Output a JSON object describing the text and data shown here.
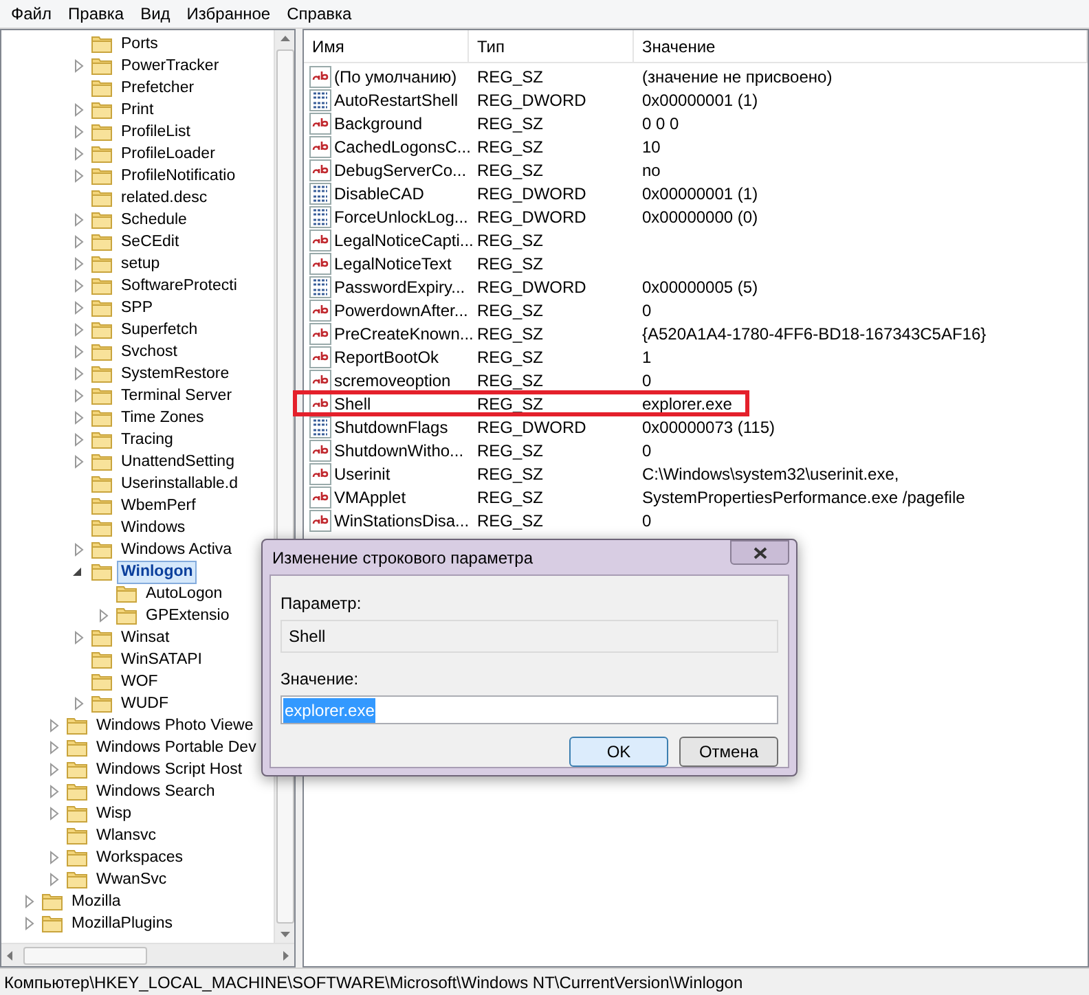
{
  "menu": [
    "Файл",
    "Правка",
    "Вид",
    "Избранное",
    "Справка"
  ],
  "tree": {
    "items": [
      {
        "children": [
          {
            "children": [
              {
                "label": "Ports",
                "kind": "leaf",
                "selected": false
              },
              {
                "label": "PowerTracker",
                "kind": "collapsed",
                "selected": false
              },
              {
                "label": "Prefetcher",
                "kind": "leaf",
                "selected": false
              },
              {
                "label": "Print",
                "kind": "collapsed",
                "selected": false
              },
              {
                "label": "ProfileList",
                "kind": "collapsed",
                "selected": false
              },
              {
                "label": "ProfileLoader",
                "kind": "collapsed",
                "selected": false
              },
              {
                "label": "ProfileNotificatio",
                "kind": "collapsed",
                "selected": false
              },
              {
                "label": "related.desc",
                "kind": "leaf",
                "selected": false
              },
              {
                "label": "Schedule",
                "kind": "collapsed",
                "selected": false
              },
              {
                "label": "SeCEdit",
                "kind": "collapsed",
                "selected": false
              },
              {
                "label": "setup",
                "kind": "collapsed",
                "selected": false
              },
              {
                "label": "SoftwareProtecti",
                "kind": "collapsed",
                "selected": false
              },
              {
                "label": "SPP",
                "kind": "collapsed",
                "selected": false
              },
              {
                "label": "Superfetch",
                "kind": "collapsed",
                "selected": false
              },
              {
                "label": "Svchost",
                "kind": "collapsed",
                "selected": false
              },
              {
                "label": "SystemRestore",
                "kind": "collapsed",
                "selected": false
              },
              {
                "label": "Terminal Server",
                "kind": "collapsed",
                "selected": false
              },
              {
                "label": "Time Zones",
                "kind": "collapsed",
                "selected": false
              },
              {
                "label": "Tracing",
                "kind": "collapsed",
                "selected": false
              },
              {
                "label": "UnattendSetting",
                "kind": "collapsed",
                "selected": false
              },
              {
                "label": "Userinstallable.d",
                "kind": "leaf",
                "selected": false
              },
              {
                "label": "WbemPerf",
                "kind": "leaf",
                "selected": false
              },
              {
                "label": "Windows",
                "kind": "leaf",
                "selected": false
              },
              {
                "label": "Windows Activa",
                "kind": "collapsed",
                "selected": false
              },
              {
                "label": "Winlogon",
                "kind": "expanded",
                "selected": true,
                "children": [
                  {
                    "label": "AutoLogon",
                    "kind": "leaf",
                    "selected": false
                  },
                  {
                    "label": "GPExtensio",
                    "kind": "collapsed",
                    "selected": false
                  }
                ]
              },
              {
                "label": "Winsat",
                "kind": "collapsed",
                "selected": false
              },
              {
                "label": "WinSATAPI",
                "kind": "leaf",
                "selected": false
              },
              {
                "label": "WOF",
                "kind": "leaf",
                "selected": false
              },
              {
                "label": "WUDF",
                "kind": "collapsed",
                "selected": false
              }
            ]
          },
          {
            "label": "Windows Photo Viewe",
            "kind": "collapsed",
            "selected": false
          },
          {
            "label": "Windows Portable Dev",
            "kind": "collapsed",
            "selected": false
          },
          {
            "label": "Windows Script Host",
            "kind": "collapsed",
            "selected": false
          },
          {
            "label": "Windows Search",
            "kind": "collapsed",
            "selected": false
          },
          {
            "label": "Wisp",
            "kind": "collapsed",
            "selected": false
          },
          {
            "label": "Wlansvc",
            "kind": "leaf",
            "selected": false
          },
          {
            "label": "Workspaces",
            "kind": "collapsed",
            "selected": false
          },
          {
            "label": "WwanSvc",
            "kind": "collapsed",
            "selected": false
          }
        ]
      },
      {
        "label": "Mozilla",
        "kind": "collapsed",
        "selected": false
      },
      {
        "label": "MozillaPlugins",
        "kind": "collapsed",
        "selected": false
      }
    ]
  },
  "table": {
    "columns": [
      "Имя",
      "Тип",
      "Значение"
    ],
    "rows": [
      {
        "kind": "string",
        "name": "(По умолчанию)",
        "type": "REG_SZ",
        "value": "(значение не присвоено)",
        "highlighted": false
      },
      {
        "kind": "binary",
        "name": "AutoRestartShell",
        "type": "REG_DWORD",
        "value": "0x00000001 (1)",
        "highlighted": false
      },
      {
        "kind": "string",
        "name": "Background",
        "type": "REG_SZ",
        "value": "0 0 0",
        "highlighted": false
      },
      {
        "kind": "string",
        "name": "CachedLogonsC...",
        "type": "REG_SZ",
        "value": "10",
        "highlighted": false
      },
      {
        "kind": "string",
        "name": "DebugServerCo...",
        "type": "REG_SZ",
        "value": "no",
        "highlighted": false
      },
      {
        "kind": "binary",
        "name": "DisableCAD",
        "type": "REG_DWORD",
        "value": "0x00000001 (1)",
        "highlighted": false
      },
      {
        "kind": "binary",
        "name": "ForceUnlockLog...",
        "type": "REG_DWORD",
        "value": "0x00000000 (0)",
        "highlighted": false
      },
      {
        "kind": "string",
        "name": "LegalNoticeCapti...",
        "type": "REG_SZ",
        "highlighted": false
      },
      {
        "kind": "string",
        "name": "LegalNoticeText",
        "type": "REG_SZ",
        "highlighted": false
      },
      {
        "kind": "binary",
        "name": "PasswordExpiry...",
        "type": "REG_DWORD",
        "value": "0x00000005 (5)",
        "highlighted": false
      },
      {
        "kind": "string",
        "name": "PowerdownAfter...",
        "type": "REG_SZ",
        "value": "0",
        "highlighted": false
      },
      {
        "kind": "string",
        "name": "PreCreateKnown...",
        "type": "REG_SZ",
        "value": "{A520A1A4-1780-4FF6-BD18-167343C5AF16}",
        "highlighted": false
      },
      {
        "kind": "string",
        "name": "ReportBootOk",
        "type": "REG_SZ",
        "value": "1",
        "highlighted": false
      },
      {
        "kind": "string",
        "name": "scremoveoption",
        "type": "REG_SZ",
        "value": "0",
        "highlighted": false
      },
      {
        "kind": "string",
        "name": "Shell",
        "type": "REG_SZ",
        "value": "explorer.exe",
        "highlighted": true
      },
      {
        "kind": "binary",
        "name": "ShutdownFlags",
        "type": "REG_DWORD",
        "value": "0x00000073 (115)",
        "highlighted": false
      },
      {
        "kind": "string",
        "name": "ShutdownWitho...",
        "type": "REG_SZ",
        "value": "0",
        "highlighted": false
      },
      {
        "kind": "string",
        "name": "Userinit",
        "type": "REG_SZ",
        "value": "C:\\Windows\\system32\\userinit.exe,",
        "highlighted": false
      },
      {
        "kind": "string",
        "name": "VMApplet",
        "type": "REG_SZ",
        "value": "SystemPropertiesPerformance.exe /pagefile",
        "highlighted": false
      },
      {
        "kind": "string",
        "name": "WinStationsDisa...",
        "type": "REG_SZ",
        "value": "0",
        "highlighted": false
      }
    ]
  },
  "dialog": {
    "title": "Изменение строкового параметра",
    "name_label": "Параметр:",
    "name_value": "Shell",
    "value_label": "Значение:",
    "value": "explorer.exe",
    "ok": "OK",
    "cancel": "Отмена"
  },
  "status_bar": "Компьютер\\HKEY_LOCAL_MACHINE\\SOFTWARE\\Microsoft\\Windows NT\\CurrentVersion\\Winlogon"
}
